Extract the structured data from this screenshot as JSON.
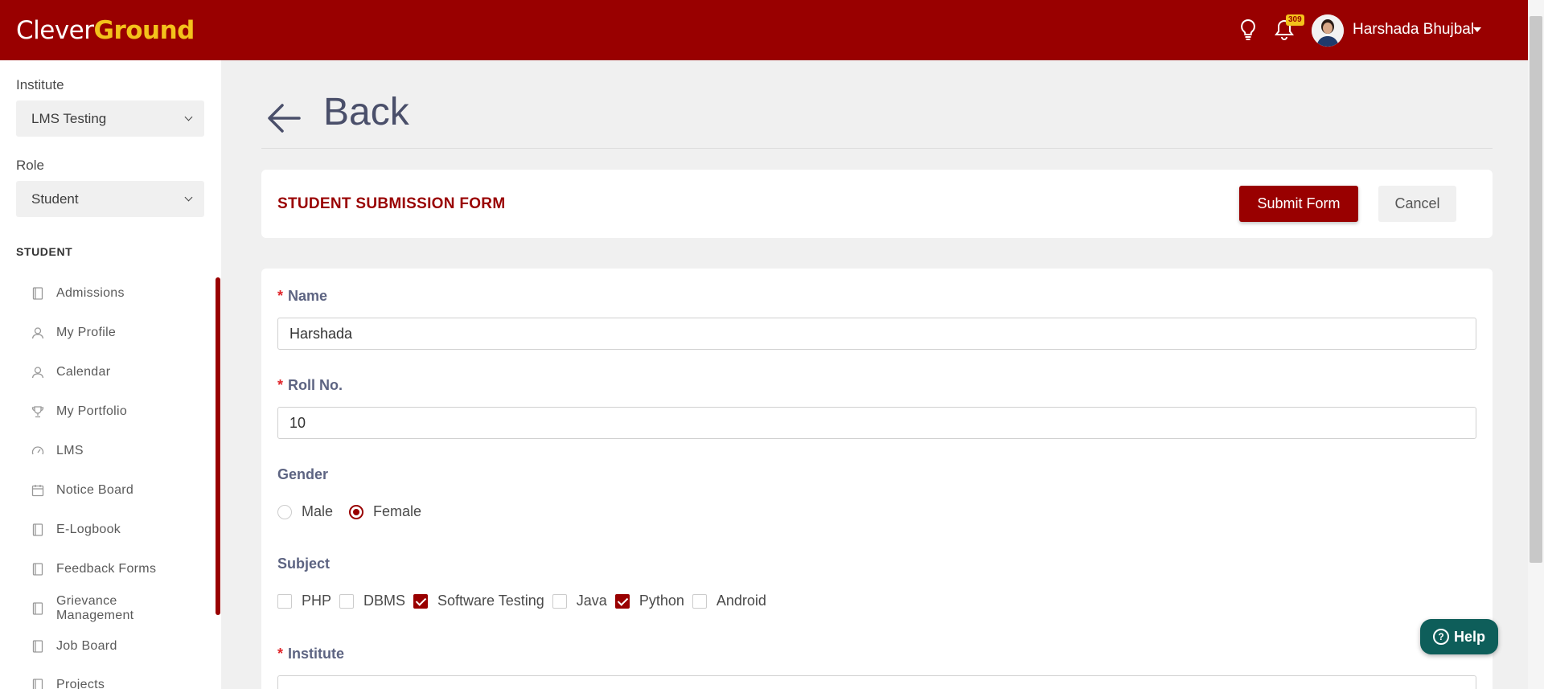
{
  "header": {
    "logo_part1": "Clever",
    "logo_part2": "Ground",
    "notification_count": "309",
    "user_name": "Harshada Bhujbal"
  },
  "sidebar": {
    "institute_label": "Institute",
    "institute_value": "LMS Testing",
    "role_label": "Role",
    "role_value": "Student",
    "section_title": "STUDENT",
    "items": [
      {
        "label": "Admissions",
        "icon": "book-icon"
      },
      {
        "label": "My Profile",
        "icon": "user-icon"
      },
      {
        "label": "Calendar",
        "icon": "user-icon"
      },
      {
        "label": "My Portfolio",
        "icon": "trophy-icon"
      },
      {
        "label": "LMS",
        "icon": "gauge-icon"
      },
      {
        "label": "Notice Board",
        "icon": "calendar-icon"
      },
      {
        "label": "E-Logbook",
        "icon": "book-icon"
      },
      {
        "label": "Feedback Forms",
        "icon": "book-icon"
      },
      {
        "label": "Grievance Management",
        "icon": "book-icon"
      },
      {
        "label": "Job Board",
        "icon": "book-icon"
      },
      {
        "label": "Projects",
        "icon": "book-icon"
      }
    ]
  },
  "main": {
    "back_label": "Back",
    "form_title": "STUDENT SUBMISSION FORM",
    "submit_label": "Submit Form",
    "cancel_label": "Cancel",
    "fields": {
      "name_label": "Name",
      "name_value": "Harshada",
      "roll_label": "Roll No.",
      "roll_value": "10",
      "gender_label": "Gender",
      "gender_options": [
        "Male",
        "Female"
      ],
      "gender_selected": "Female",
      "subject_label": "Subject",
      "subjects": [
        {
          "label": "PHP",
          "checked": false
        },
        {
          "label": "DBMS",
          "checked": false
        },
        {
          "label": "Software Testing",
          "checked": true
        },
        {
          "label": "Java",
          "checked": false
        },
        {
          "label": "Python",
          "checked": true
        },
        {
          "label": "Android",
          "checked": false
        }
      ],
      "institute_label": "Institute"
    },
    "help_label": "Help"
  },
  "colors": {
    "brand": "#990000",
    "logo_accent": "#f3c21b",
    "help": "#0e5e5a"
  }
}
